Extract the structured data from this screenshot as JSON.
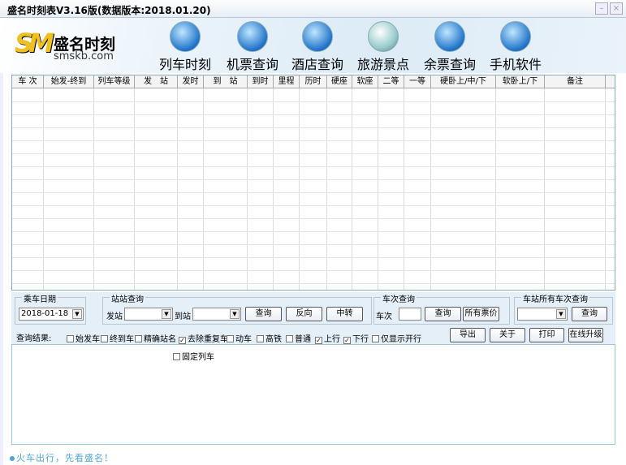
{
  "window": {
    "title": "盛名时刻表V3.16版(数据版本:2018.01.20)",
    "minimize": "–",
    "close": "×"
  },
  "logo": {
    "mark": "SM",
    "name": "盛名时刻",
    "site": "smskb.com"
  },
  "nav": [
    {
      "label": "列车时刻",
      "icon": "train-icon"
    },
    {
      "label": "机票查询",
      "icon": "plane-icon"
    },
    {
      "label": "酒店查询",
      "icon": "hotel-icon"
    },
    {
      "label": "旅游景点",
      "icon": "globe-icon"
    },
    {
      "label": "余票查询",
      "icon": "windows-icon"
    },
    {
      "label": "手机软件",
      "icon": "java-icon"
    }
  ],
  "table": {
    "columns": [
      "车 次",
      "始发-终到",
      "列车等级",
      "发　站",
      "发时",
      "到　站",
      "到时",
      "里程",
      "历时",
      "硬座",
      "软座",
      "二等",
      "一等",
      "硬卧上/中/下",
      "软卧上/下",
      "备注"
    ],
    "rows": []
  },
  "date_group": {
    "caption": "乘车日期",
    "value": "2018-01-18"
  },
  "station_group": {
    "caption": "站站查询",
    "from_label": "发站",
    "from_value": "",
    "to_label": "到站",
    "to_value": "",
    "query": "查询",
    "reverse": "反向",
    "transfer": "中转"
  },
  "train_group": {
    "caption": "车次查询",
    "label": "车次",
    "value": "",
    "query": "查询",
    "all_prices": "所有票价"
  },
  "station_all_group": {
    "caption": "车站所有车次查询",
    "value": "",
    "query": "查询"
  },
  "filters": {
    "label": "查询结果:",
    "options": [
      {
        "label": "始发车",
        "checked": false
      },
      {
        "label": "终到车",
        "checked": false
      },
      {
        "label": "精确站名",
        "checked": false
      },
      {
        "label": "去除重复车",
        "checked": true
      },
      {
        "label": "动车",
        "checked": false
      },
      {
        "label": "高铁",
        "checked": false
      },
      {
        "label": "普通",
        "checked": false
      },
      {
        "label": "上行",
        "checked": true
      },
      {
        "label": "下行",
        "checked": true
      },
      {
        "label": "仅显示开行",
        "checked": false
      }
    ],
    "fixed": {
      "label": "固定列车",
      "checked": false
    }
  },
  "actions": {
    "export": "导出",
    "about": "关于",
    "print": "打印",
    "upgrade": "在线升级"
  },
  "status": "火车出行，先看盛名！"
}
